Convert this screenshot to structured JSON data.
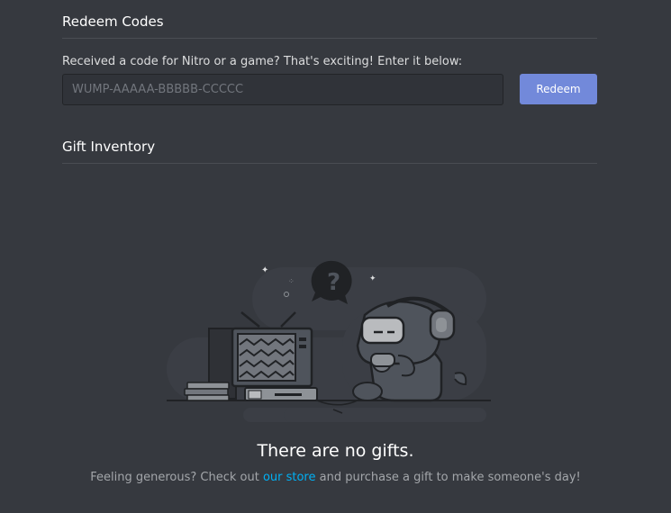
{
  "redeem": {
    "title": "Redeem Codes",
    "prompt": "Received a code for Nitro or a game? That's exciting! Enter it below:",
    "input_placeholder": "WUMP-AAAAA-BBBBB-CCCCC",
    "input_value": "",
    "button_label": "Redeem"
  },
  "inventory": {
    "title": "Gift Inventory",
    "empty_title": "There are no gifts.",
    "empty_sub_before": "Feeling generous? Check out ",
    "empty_sub_link": "our store",
    "empty_sub_after": " and purchase a gift to make someone's day!"
  },
  "colors": {
    "background": "#36393f",
    "accent": "#7289da",
    "link": "#00b0f4"
  }
}
